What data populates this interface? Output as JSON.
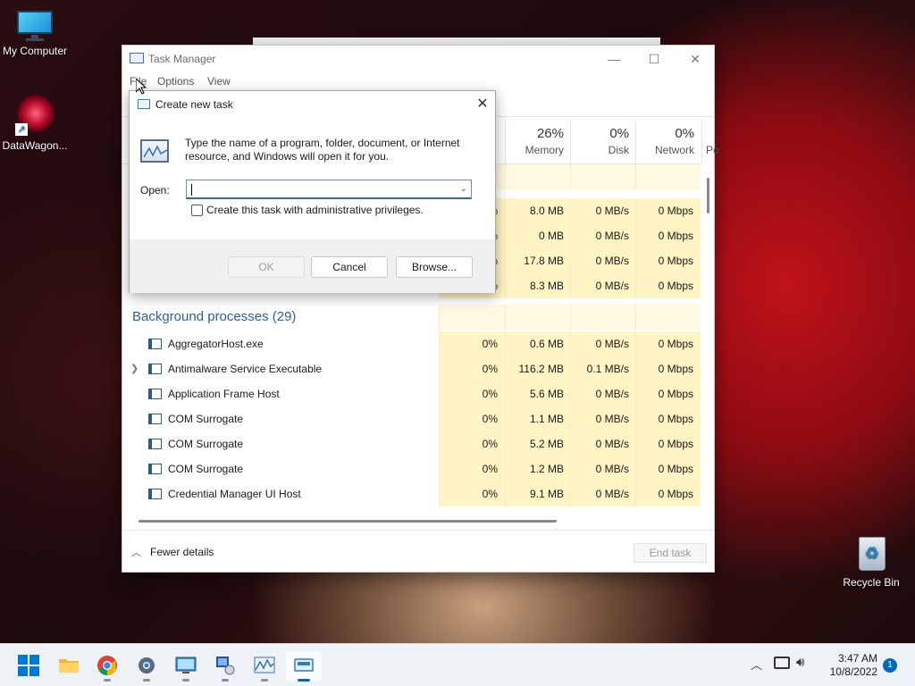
{
  "desktop": {
    "icons": [
      {
        "label": "My Computer"
      },
      {
        "label": "DataWagon..."
      },
      {
        "label": "Recycle Bin"
      }
    ]
  },
  "task_manager": {
    "title": "Task Manager",
    "menu": [
      "File",
      "Options",
      "View"
    ],
    "columns": {
      "memory": {
        "pct": "26%",
        "label": "Memory"
      },
      "disk": {
        "pct": "0%",
        "label": "Disk"
      },
      "network": {
        "pct": "0%",
        "label": "Network"
      },
      "power": {
        "label": "Po"
      }
    },
    "app_rows": [
      {
        "cpu": "%",
        "memory": "8.0 MB",
        "disk": "0 MB/s",
        "network": "0 Mbps"
      },
      {
        "cpu": "%",
        "memory": "0 MB",
        "disk": "0 MB/s",
        "network": "0 Mbps"
      },
      {
        "cpu": "%",
        "memory": "17.8 MB",
        "disk": "0 MB/s",
        "network": "0 Mbps"
      },
      {
        "cpu": "%",
        "memory": "8.3 MB",
        "disk": "0 MB/s",
        "network": "0 Mbps"
      }
    ],
    "background_section": "Background processes (29)",
    "processes": [
      {
        "name": "AggregatorHost.exe",
        "cpu": "0%",
        "memory": "0.6 MB",
        "disk": "0 MB/s",
        "network": "0 Mbps"
      },
      {
        "name": "Antimalware Service Executable",
        "cpu": "0%",
        "memory": "116.2 MB",
        "disk": "0.1 MB/s",
        "network": "0 Mbps"
      },
      {
        "name": "Application Frame Host",
        "cpu": "0%",
        "memory": "5.6 MB",
        "disk": "0 MB/s",
        "network": "0 Mbps"
      },
      {
        "name": "COM Surrogate",
        "cpu": "0%",
        "memory": "1.1 MB",
        "disk": "0 MB/s",
        "network": "0 Mbps"
      },
      {
        "name": "COM Surrogate",
        "cpu": "0%",
        "memory": "5.2 MB",
        "disk": "0 MB/s",
        "network": "0 Mbps"
      },
      {
        "name": "COM Surrogate",
        "cpu": "0%",
        "memory": "1.2 MB",
        "disk": "0 MB/s",
        "network": "0 Mbps"
      },
      {
        "name": "Credential Manager UI Host",
        "cpu": "0%",
        "memory": "9.1 MB",
        "disk": "0 MB/s",
        "network": "0 Mbps"
      }
    ],
    "footer": {
      "fewer_details": "Fewer details",
      "end_task": "End task"
    }
  },
  "dialog": {
    "title": "Create new task",
    "description": "Type the name of a program, folder, document, or Internet resource, and Windows will open it for you.",
    "open_label": "Open:",
    "open_value": "",
    "admin_label": "Create this task with administrative privileges.",
    "admin_checked": false,
    "ok": "OK",
    "cancel": "Cancel",
    "browse": "Browse..."
  },
  "taskbar": {
    "items": [
      "start",
      "file-explorer",
      "chrome",
      "settings",
      "remote-desktop",
      "network-manager",
      "task-manager",
      "run"
    ],
    "time": "3:47 AM",
    "date": "10/8/2022",
    "notifications": "1"
  }
}
